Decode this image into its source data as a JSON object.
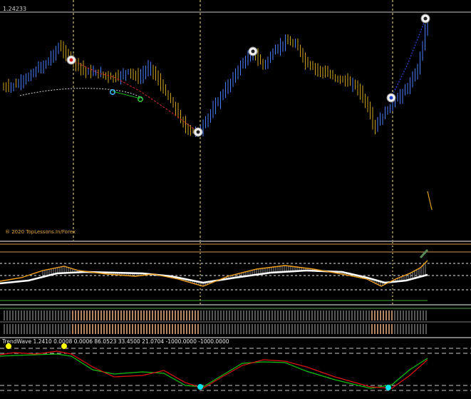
{
  "main_chart": {
    "price_label": "1.24233",
    "copyright": "® 2020 TopLessons.In/Forex",
    "colors": {
      "up_bar": "#4a7dff",
      "down_bar": "#c8a21e",
      "price_line": "#c9c9c9",
      "vline": "#f0e68c",
      "wave_down": "#d42a2a",
      "wave_up": "#2a4bd6",
      "ma_line": "#d8d8d8",
      "green_line": "#18b218"
    }
  },
  "indicator_1": {
    "colors": {
      "fast": "#f0a020",
      "slow": "#ffffff",
      "hist": "#8c8c8c",
      "level": "#ffb060"
    }
  },
  "indicator_2": {
    "colors": {
      "bars": "#ffbe8c",
      "level": "#4da34d"
    }
  },
  "indicator_3": {
    "label": "TrendWave 1.2410 0.0008 0.0006 86.0523 33.4500 21.0704 -1000.0000 -1000.0000",
    "colors": {
      "red": "#e01010",
      "green": "#10c010",
      "dots_yellow": "#ffff00",
      "dots_cyan": "#00e5ee",
      "levels": "#c8c8c8"
    }
  }
}
